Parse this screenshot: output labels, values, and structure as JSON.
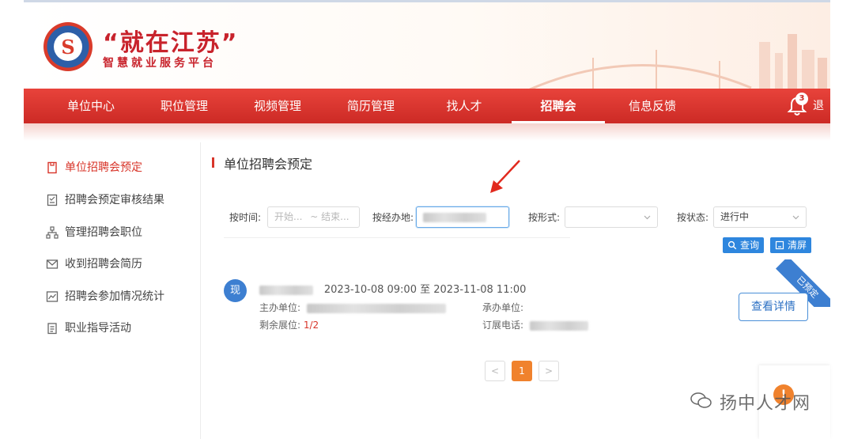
{
  "brand": {
    "title": "“就在江苏”",
    "subtitle": "智慧就业服务平台"
  },
  "nav": {
    "items": [
      {
        "label": "单位中心"
      },
      {
        "label": "职位管理"
      },
      {
        "label": "视频管理"
      },
      {
        "label": "简历管理"
      },
      {
        "label": "找人才"
      },
      {
        "label": "招聘会",
        "active": true
      },
      {
        "label": "信息反馈"
      }
    ],
    "notification_count": "3",
    "logout_label": "退出"
  },
  "sidebar": {
    "items": [
      {
        "label": "单位招聘会预定",
        "icon": "document-icon",
        "active": true
      },
      {
        "label": "招聘会预定审核结果",
        "icon": "checklist-icon"
      },
      {
        "label": "管理招聘会职位",
        "icon": "org-chart-icon"
      },
      {
        "label": "收到招聘会简历",
        "icon": "mail-icon"
      },
      {
        "label": "招聘会参加情况统计",
        "icon": "chart-icon"
      },
      {
        "label": "职业指导活动",
        "icon": "clipboard-icon"
      }
    ]
  },
  "main": {
    "title": "单位招聘会预定",
    "filters": {
      "time_label": "按时间:",
      "time_start_placeholder": "开始...",
      "time_sep": "~",
      "time_end_placeholder": "结束...",
      "place_label": "按经办地:",
      "form_label": "按形式:",
      "status_label": "按状态:",
      "status_value": "进行中"
    },
    "buttons": {
      "search_label": "查询",
      "clear_label": "清屏"
    },
    "result": {
      "avatar_text": "现",
      "date_range": "2023-10-08 09:00 至 2023-11-08 11:00",
      "organizer_label": "主办单位:",
      "co_organizer_label": "承办单位:",
      "remaining_label": "剩余展位:",
      "remaining_value": "1/2",
      "phone_label": "订展电话:",
      "ribbon_label": "已预定",
      "detail_button": "查看详情"
    },
    "pagination": {
      "prev": "<",
      "current": "1",
      "next": ">"
    }
  },
  "watermark": {
    "text": "扬中人才网"
  },
  "colors": {
    "nav_red": "#cc2a25",
    "accent_red": "#d8352a",
    "primary_blue": "#2e86de",
    "page_orange": "#f0822d"
  }
}
